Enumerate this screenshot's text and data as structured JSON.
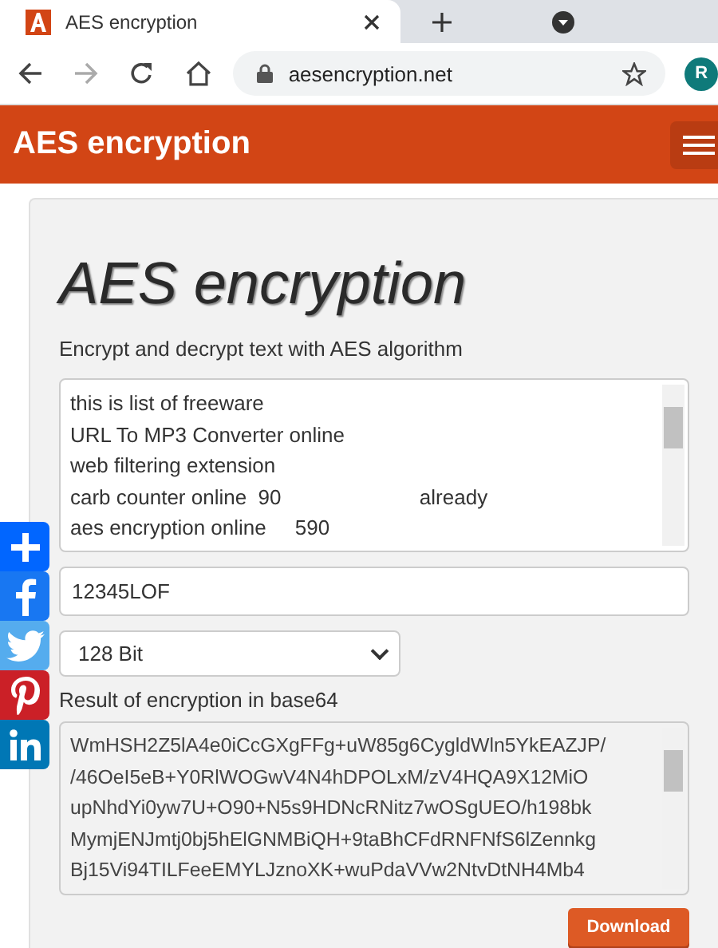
{
  "browser": {
    "tab": {
      "title": "AES encryption",
      "selected": true
    },
    "url": "aesencryption.net",
    "avatar": "R",
    "forward_disabled": true
  },
  "header": {
    "title": "AES encryption"
  },
  "main": {
    "title": "AES encryption",
    "subtitle": "Encrypt and decrypt text with AES algorithm",
    "input_text": [
      "this is list of freeware",
      "URL To MP3 Converter online",
      "web filtering extension",
      "carb counter online  90                        already",
      "aes encryption online     590"
    ],
    "key": "12345LOF",
    "key_size": "128 Bit",
    "result_label": "Result of encryption in base64",
    "result": [
      "WmHSH2Z5lA4e0iCcGXgFFg+uW85g6CygldWln5YkEAZJP/",
      "/46OeI5eB+Y0RlWOGwV4N4hDPOLxM/zV4HQA9X12MiO",
      "upNhdYi0yw7U+O90+N5s9HDNcRNitz7wOSgUEO/h198bk",
      "MymjENJmtj0bj5hElGNMBiQH+9taBhCFdRNFNfS6lZennkg",
      "Bj15Vi94TILFeeEMYLJznoXK+wuPdaVVw2NtvDtNH4Mb4"
    ],
    "download": "Download"
  },
  "share": [
    {
      "kind": "plus",
      "color": "#0166ff"
    },
    {
      "kind": "facebook",
      "color": "#1877f2"
    },
    {
      "kind": "twitter",
      "color": "#55acee"
    },
    {
      "kind": "pinterest",
      "color": "#cb2027"
    },
    {
      "kind": "linkedin",
      "color": "#0077b5"
    }
  ]
}
